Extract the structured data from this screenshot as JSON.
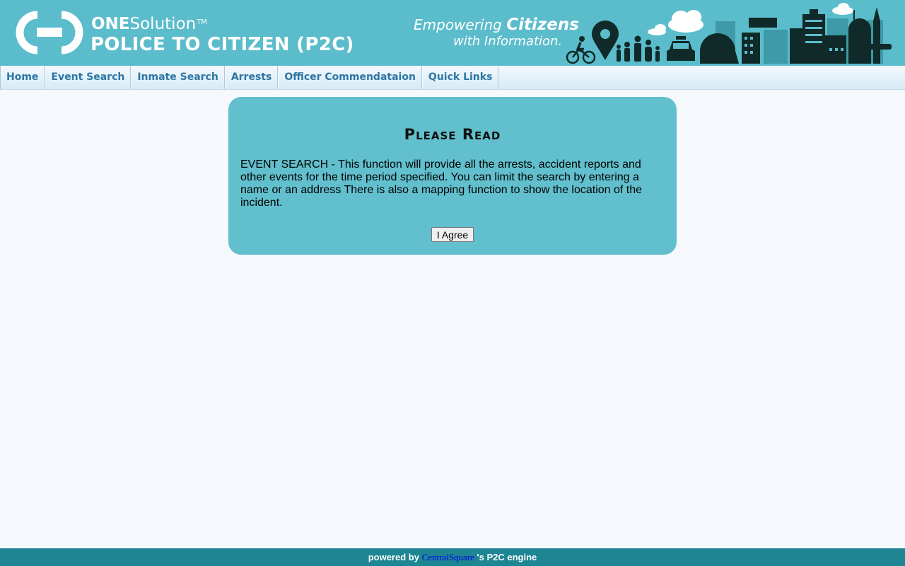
{
  "header": {
    "brand_bold": "ONE",
    "brand_light": "Solution",
    "brand_tm": "TM",
    "product_name": "POLICE TO CITIZEN (P2C)",
    "tagline_prefix": "Empowering ",
    "tagline_emphasis": "Citizens",
    "tagline_line2": "with Information.",
    "icons": [
      "onesolution-logo-icon",
      "city-skyline-icon"
    ]
  },
  "nav": {
    "items": [
      {
        "label": "Home"
      },
      {
        "label": "Event Search"
      },
      {
        "label": "Inmate Search"
      },
      {
        "label": "Arrests"
      },
      {
        "label": "Officer Commendataion"
      },
      {
        "label": "Quick Links"
      }
    ]
  },
  "notice": {
    "title": "Please Read",
    "body": "EVENT SEARCH - This function will provide all the arrests, accident reports and other events for the time period specified. You can limit the search by entering a name or an address There is also a mapping function to show the location of the incident.",
    "agree_label": "I Agree"
  },
  "footer": {
    "prefix": "powered by ",
    "vendor": "CentralSquare",
    "suffix": " 's P2C engine"
  },
  "colors": {
    "banner": "#5bbccb",
    "panel": "#62bfcd",
    "footer": "#1e8593",
    "nav_text": "#2e76a4",
    "page_background": "#f5f8fc"
  }
}
